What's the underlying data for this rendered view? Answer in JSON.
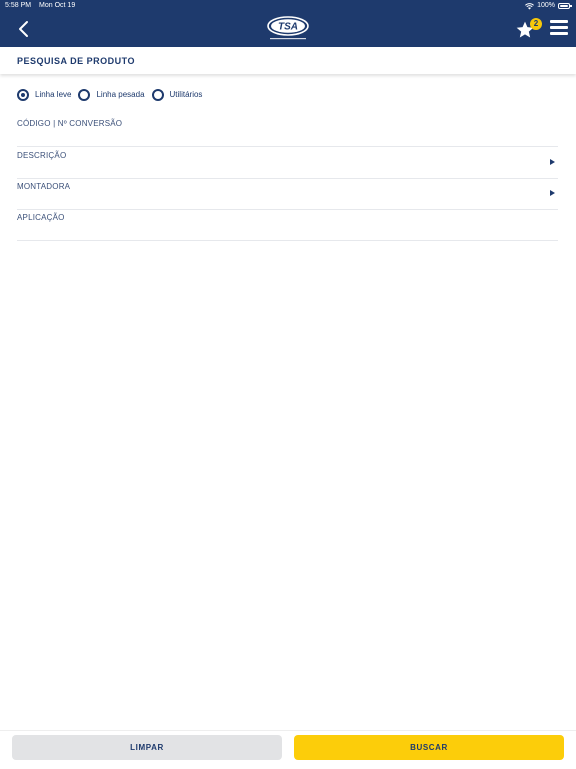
{
  "status_bar": {
    "time": "5:58 PM",
    "date": "Mon Oct 19",
    "battery": "100%"
  },
  "header": {
    "logo_text": "TSA",
    "favorites_count": "2"
  },
  "page": {
    "title": "PESQUISA DE PRODUTO"
  },
  "product_line": {
    "options": [
      {
        "label": "Linha leve",
        "selected": true
      },
      {
        "label": "Linha pesada",
        "selected": false
      },
      {
        "label": "Utilitários",
        "selected": false
      }
    ]
  },
  "fields": {
    "code": "CÓDIGO | Nº CONVERSÃO",
    "description": "DESCRIÇÃO",
    "manufacturer": "MONTADORA",
    "application": "APLICAÇÃO"
  },
  "actions": {
    "clear_label": "LIMPAR",
    "search_label": "BUSCAR"
  },
  "colors": {
    "primary": "#1e3a6d",
    "accent": "#fccd0a",
    "secondary_button": "#e2e3e5"
  },
  "icons": {
    "back": "chevron-left-icon",
    "favorites": "star-icon",
    "menu": "hamburger-menu-icon",
    "field_arrow": "triangle-right-icon"
  }
}
